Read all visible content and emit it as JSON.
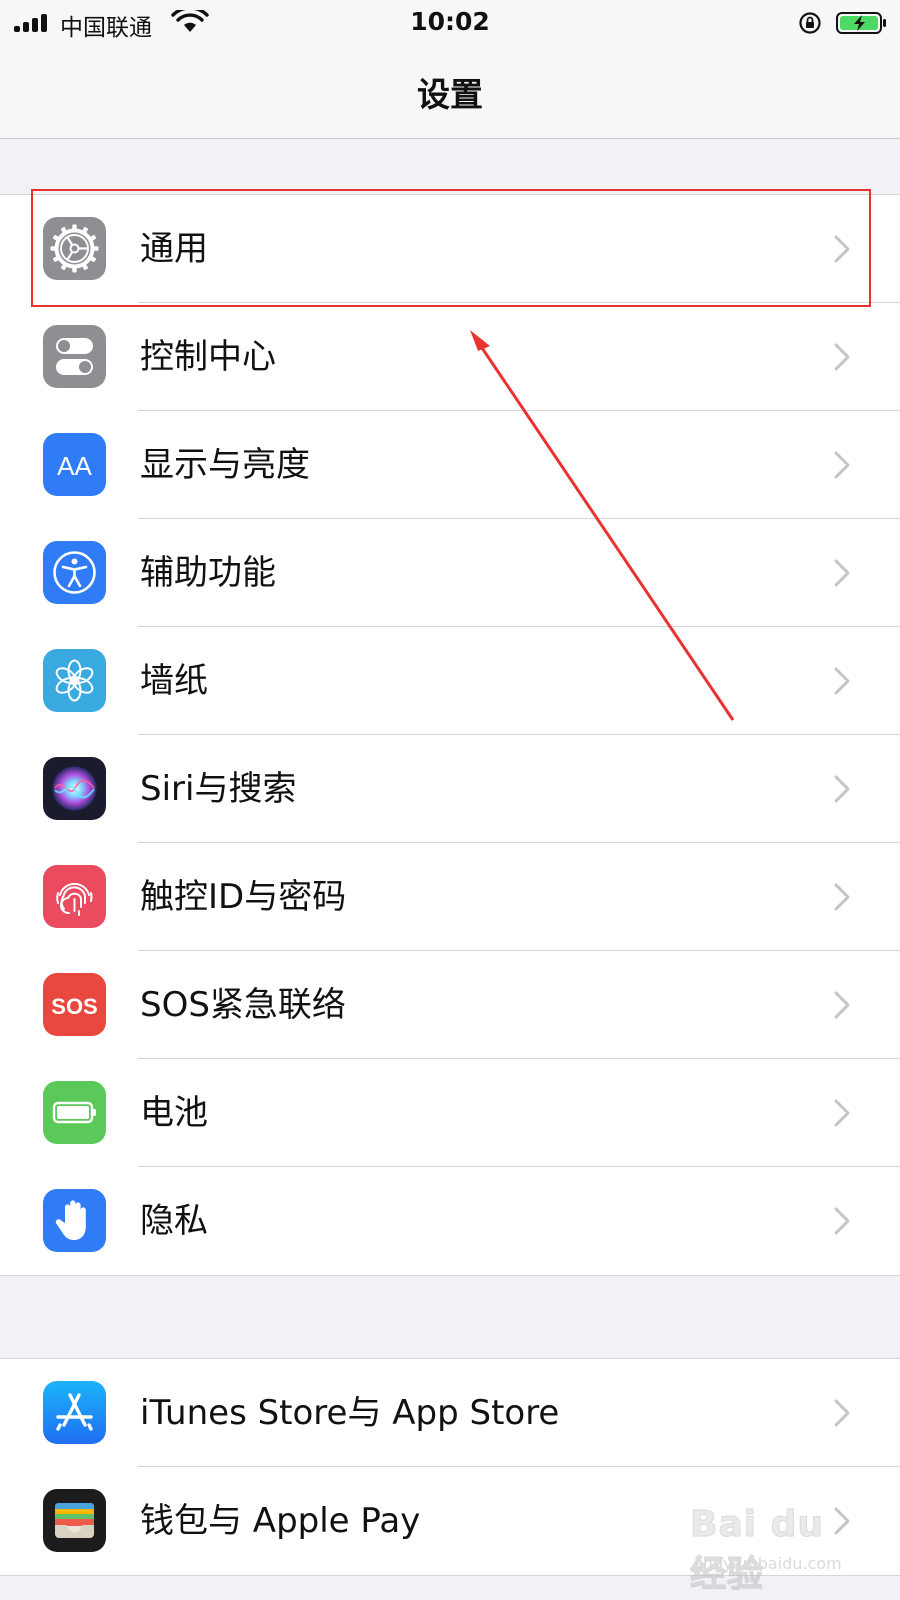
{
  "status_bar": {
    "carrier": "中国联通",
    "time": "10:02"
  },
  "nav": {
    "title": "设置"
  },
  "groups": [
    {
      "items": [
        {
          "label": "通用",
          "icon": "gear-icon",
          "color": "#8e8e93"
        },
        {
          "label": "控制中心",
          "icon": "control-center-icon",
          "color": "#8e8e93"
        },
        {
          "label": "显示与亮度",
          "icon": "display-aa-icon",
          "color": "#2f7cf6"
        },
        {
          "label": "辅助功能",
          "icon": "accessibility-icon",
          "color": "#2f7cf6"
        },
        {
          "label": "墙纸",
          "icon": "wallpaper-flower-icon",
          "color": "#39a9e0"
        },
        {
          "label": "Siri与搜索",
          "icon": "siri-icon",
          "color": "#1b1b2e"
        },
        {
          "label": "触控ID与密码",
          "icon": "fingerprint-icon",
          "color": "#ea4b5f"
        },
        {
          "label": "SOS紧急联络",
          "icon": "sos-icon",
          "color": "#e8483e"
        },
        {
          "label": "电池",
          "icon": "battery-icon",
          "color": "#5bc85a"
        },
        {
          "label": "隐私",
          "icon": "hand-icon",
          "color": "#2f7cf6"
        }
      ]
    },
    {
      "items": [
        {
          "label": "iTunes Store与 App Store",
          "icon": "app-store-icon",
          "color": "#2196f3"
        },
        {
          "label": "钱包与 Apple Pay",
          "icon": "wallet-icon",
          "color": "#1c1c1c"
        }
      ]
    }
  ],
  "sos_icon_text": "SOS",
  "watermark": {
    "brand": "Bai du 经验",
    "url": "jingyan.baidu.com"
  },
  "annotation_color": "#e8332e"
}
